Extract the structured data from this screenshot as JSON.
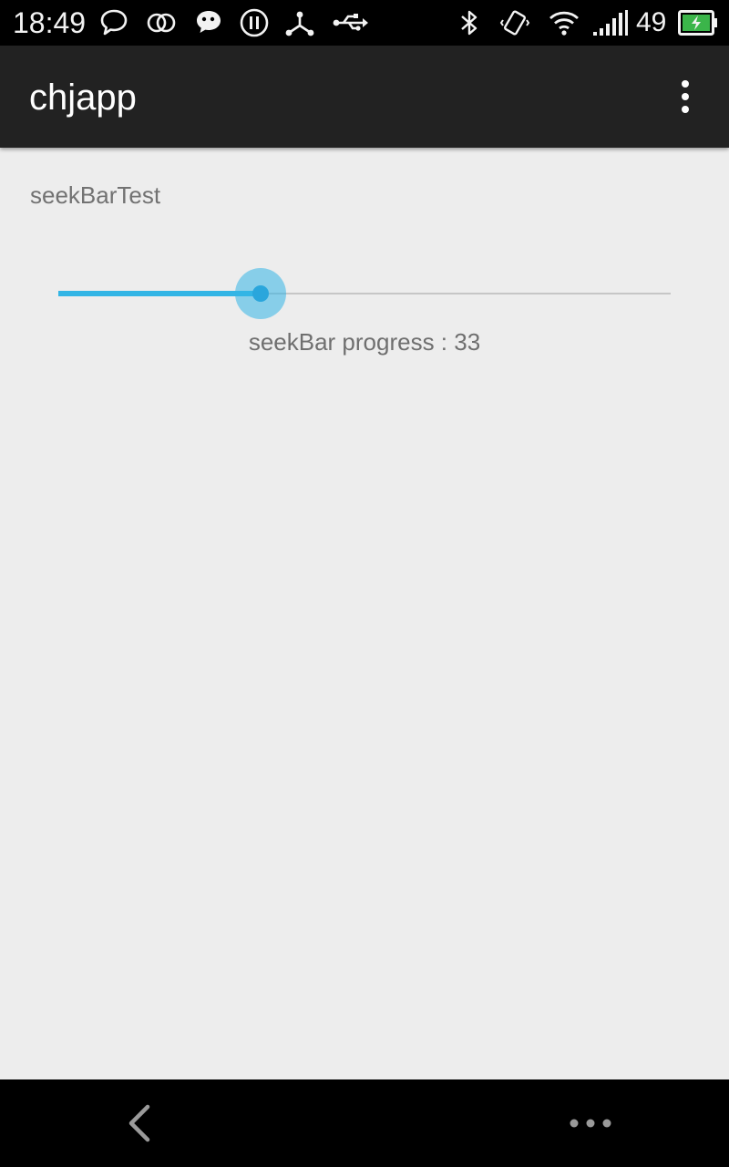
{
  "status_bar": {
    "time": "18:49",
    "battery_level": "49",
    "icons_left": [
      "chat-bubble-icon",
      "linked-rings-icon",
      "wechat-icon",
      "pause-circle-icon",
      "network-share-icon",
      "usb-icon"
    ],
    "icons_right": [
      "bluetooth-icon",
      "vibrate-icon",
      "wifi-icon",
      "signal-icon",
      "battery-charging-icon"
    ]
  },
  "app_bar": {
    "title": "chjapp",
    "menu_icon": "overflow-menu-icon"
  },
  "content": {
    "section_label": "seekBarTest",
    "seekbar": {
      "progress": 33,
      "max": 100
    },
    "progress_text": "seekBar progress : 33"
  },
  "nav_bar": {
    "icons": [
      "back-chevron-icon",
      "more-dots-icon"
    ]
  },
  "colors": {
    "accent": "#33b5e5",
    "app_bar_bg": "#222222",
    "content_bg": "#ededed",
    "status_bar_bg": "#000000"
  }
}
